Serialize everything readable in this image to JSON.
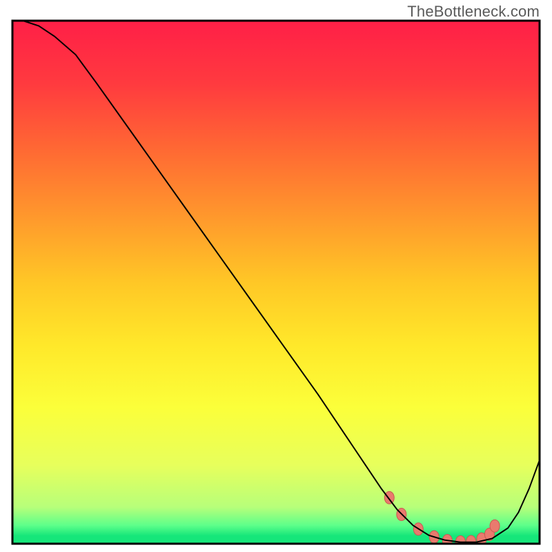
{
  "watermark": "TheBottleneck.com",
  "chart_data": {
    "type": "line",
    "title": "",
    "xlabel": "",
    "ylabel": "",
    "xlim": [
      0,
      100
    ],
    "ylim": [
      0,
      100
    ],
    "background": {
      "type": "vertical-gradient",
      "stops": [
        {
          "offset": 0.0,
          "color": "#ff1f47"
        },
        {
          "offset": 0.12,
          "color": "#ff3a3f"
        },
        {
          "offset": 0.25,
          "color": "#ff6a33"
        },
        {
          "offset": 0.38,
          "color": "#ff9a2c"
        },
        {
          "offset": 0.5,
          "color": "#ffc726"
        },
        {
          "offset": 0.62,
          "color": "#ffe82a"
        },
        {
          "offset": 0.74,
          "color": "#fbff3a"
        },
        {
          "offset": 0.85,
          "color": "#e7ff5c"
        },
        {
          "offset": 0.93,
          "color": "#b7ff7a"
        },
        {
          "offset": 0.965,
          "color": "#5dff8a"
        },
        {
          "offset": 0.985,
          "color": "#16e67a"
        },
        {
          "offset": 1.0,
          "color": "#16e67a"
        }
      ]
    },
    "series": [
      {
        "name": "bottleneck-curve",
        "stroke": "#000000",
        "stroke_width": 2,
        "x": [
          2,
          5,
          8,
          12,
          16,
          22,
          28,
          34,
          40,
          46,
          52,
          58,
          63,
          67,
          70,
          73,
          76,
          79,
          82,
          85,
          88,
          91,
          94,
          96,
          98,
          100
        ],
        "y": [
          100,
          99,
          97,
          93.5,
          88,
          79.5,
          71,
          62.5,
          54,
          45.5,
          37,
          28.5,
          21,
          15,
          10.5,
          6.5,
          3.5,
          1.6,
          0.7,
          0.3,
          0.3,
          1.0,
          3.0,
          6.0,
          10.5,
          16
        ]
      }
    ],
    "markers": {
      "color": "#e97a6e",
      "stroke": "#c95a50",
      "points_x": [
        71.5,
        73.8,
        77,
        80,
        82.5,
        85,
        87,
        89,
        90.5,
        91.5
      ],
      "points_y": [
        8.8,
        5.6,
        2.8,
        1.3,
        0.6,
        0.35,
        0.4,
        0.9,
        1.8,
        3.4
      ]
    },
    "frame": {
      "stroke": "#000000",
      "stroke_width": 3
    }
  }
}
